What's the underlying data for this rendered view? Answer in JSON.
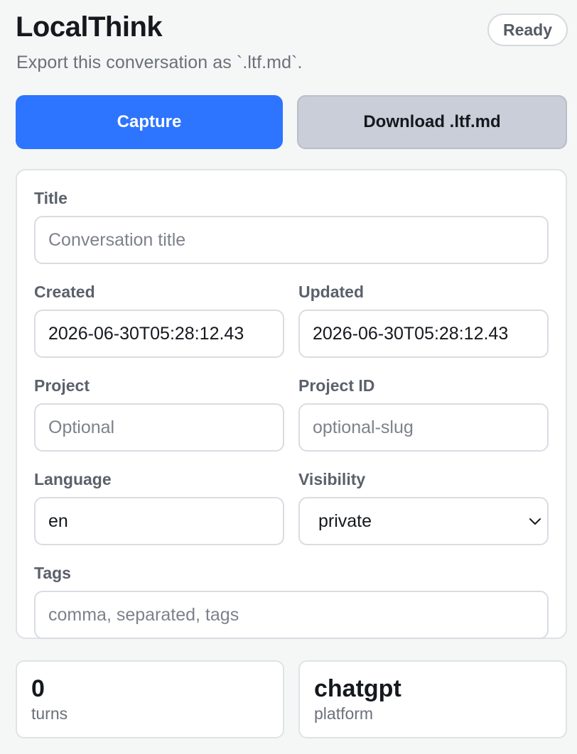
{
  "header": {
    "title": "LocalThink",
    "subtitle": "Export this conversation as `.ltf.md`.",
    "status": "Ready"
  },
  "actions": {
    "capture_label": "Capture",
    "download_label": "Download .ltf.md"
  },
  "form": {
    "title": {
      "label": "Title",
      "value": "",
      "placeholder": "Conversation title"
    },
    "created": {
      "label": "Created",
      "value": "2026-06-30T05:28:12.43"
    },
    "updated": {
      "label": "Updated",
      "value": "2026-06-30T05:28:12.43"
    },
    "project": {
      "label": "Project",
      "value": "",
      "placeholder": "Optional"
    },
    "project_id": {
      "label": "Project ID",
      "value": "",
      "placeholder": "optional-slug"
    },
    "language": {
      "label": "Language",
      "value": "en"
    },
    "visibility": {
      "label": "Visibility",
      "value": "private",
      "icon": "chevron-down-icon"
    },
    "tags": {
      "label": "Tags",
      "value": "",
      "placeholder": "comma, separated, tags"
    }
  },
  "stats": [
    {
      "value": "0",
      "label": "turns"
    },
    {
      "value": "chatgpt",
      "label": "platform"
    }
  ],
  "colors": {
    "accent": "#2d74ff",
    "secondary_button": "#c9ced8",
    "background": "#f5f6f6"
  }
}
